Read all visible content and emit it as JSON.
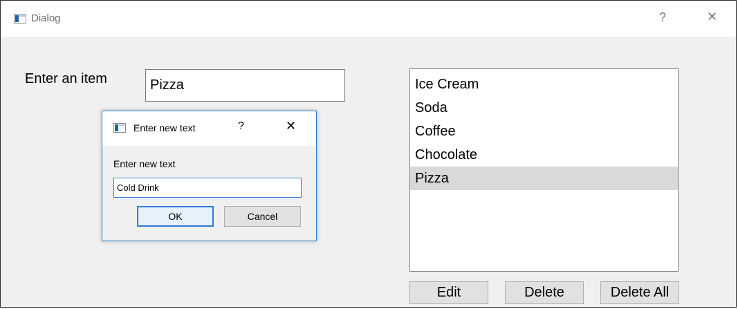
{
  "window": {
    "title": "Dialog",
    "help_glyph": "?",
    "close_glyph": "✕"
  },
  "form": {
    "item_label": "Enter an item",
    "item_value": "Pizza"
  },
  "list": {
    "items": [
      "Ice Cream",
      "Soda",
      "Coffee",
      "Chocolate",
      "Pizza"
    ],
    "selected": "Pizza"
  },
  "buttons": {
    "edit": "Edit",
    "delete": "Delete",
    "delete_all": "Delete All"
  },
  "input_dialog": {
    "title": "Enter new text",
    "help_glyph": "?",
    "close_glyph": "✕",
    "label": "Enter new text",
    "value": "Cold Drink",
    "ok": "OK",
    "cancel": "Cancel"
  },
  "icons": {
    "window_icon": "app-window-icon",
    "dialog_icon": "app-window-icon"
  },
  "colors": {
    "accent": "#2d7bd4",
    "selection": "#d9d9d9",
    "window_bg": "#f0f0f0"
  }
}
